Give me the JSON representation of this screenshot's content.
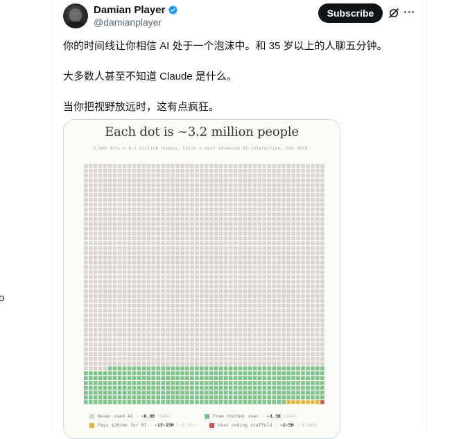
{
  "post": {
    "author": {
      "display_name": "Damian Player",
      "handle": "@damianplayer",
      "verified": true,
      "avatar_icon": "avatar-photo"
    },
    "subscribe_label": "Subscribe",
    "text_lines": [
      "你的时间线让你相信 AI 处于一个泡沫中。和 35 岁以上的人聊五分钟。",
      "大多数人甚至不知道 Claude 是什么。",
      "当你把视野放远时，这有点疯狂。"
    ],
    "left_edge_fragment": "o"
  },
  "chart": {
    "title": "Each dot is ~3.2 million people",
    "subtitle": "2,500 dots = 8.1 billion humans. Color = most advanced AI interaction, Feb 2026.",
    "grid": {
      "columns": 50,
      "rows": 50
    },
    "legend": [
      {
        "label": "Never used AI · ",
        "value": "~6.8B",
        "pct": "(84%)",
        "color": "#d8d5cf"
      },
      {
        "label": "Free chatbot user · ",
        "value": "~1.3B",
        "pct": "(16%)",
        "color": "#7cc48a"
      },
      {
        "label": "Pays $20/mo for AI · ",
        "value": "~15-25M",
        "pct": "(~0.3%)",
        "color": "#e9b73c"
      },
      {
        "label": "Uses coding scaffold · ",
        "value": "~2-5M",
        "pct": "(~0.04%)",
        "color": "#d2564d"
      }
    ]
  },
  "chart_data": {
    "type": "waffle",
    "title": "Each dot is ~3.2 million people",
    "categories": [
      "Never used AI",
      "Free chatbot user",
      "Pays $20/mo for AI",
      "Uses coding scaffold"
    ],
    "values_text": [
      "~6.8B",
      "~1.3B",
      "~15-25M",
      "~2-5M"
    ],
    "percent_text": [
      "(84%)",
      "(16%)",
      "(~0.3%)",
      "(~0.04%)"
    ],
    "dot_counts": [
      2105,
      387,
      7,
      1
    ],
    "total_dots": 2500,
    "colors": [
      "#d8d5cf",
      "#7cc48a",
      "#e9b73c",
      "#d2564d"
    ]
  }
}
